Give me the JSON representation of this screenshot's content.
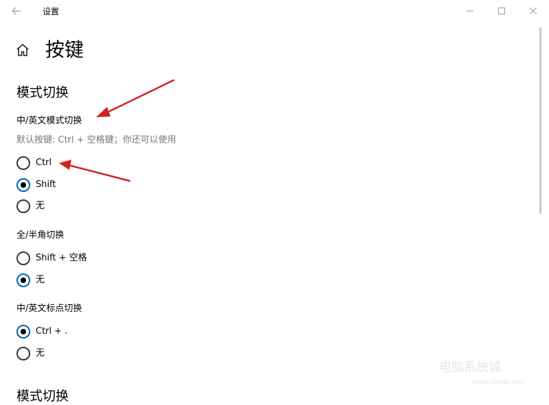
{
  "window": {
    "title": "设置"
  },
  "page": {
    "title": "按键"
  },
  "section": {
    "title": "模式切换"
  },
  "groups": [
    {
      "label": "中/英文模式切换",
      "description": "默认按键: Ctrl + 空格键；你还可以使用",
      "options": [
        {
          "label": "Ctrl",
          "checked": false
        },
        {
          "label": "Shift",
          "checked": true
        },
        {
          "label": "无",
          "checked": false
        }
      ]
    },
    {
      "label": "全/半角切换",
      "options": [
        {
          "label": "Shift + 空格",
          "checked": false
        },
        {
          "label": "无",
          "checked": true
        }
      ]
    },
    {
      "label": "中/英文标点切换",
      "options": [
        {
          "label": "Ctrl + .",
          "checked": true
        },
        {
          "label": "无",
          "checked": false
        }
      ]
    }
  ],
  "next_section": {
    "title": "模式切换"
  },
  "watermark": {
    "text": "电脑系统城",
    "sub": "www.dnxtc.net"
  },
  "colors": {
    "accent": "#0063b1",
    "annotation_arrow": "#d42020",
    "secondary_text": "#767676"
  }
}
